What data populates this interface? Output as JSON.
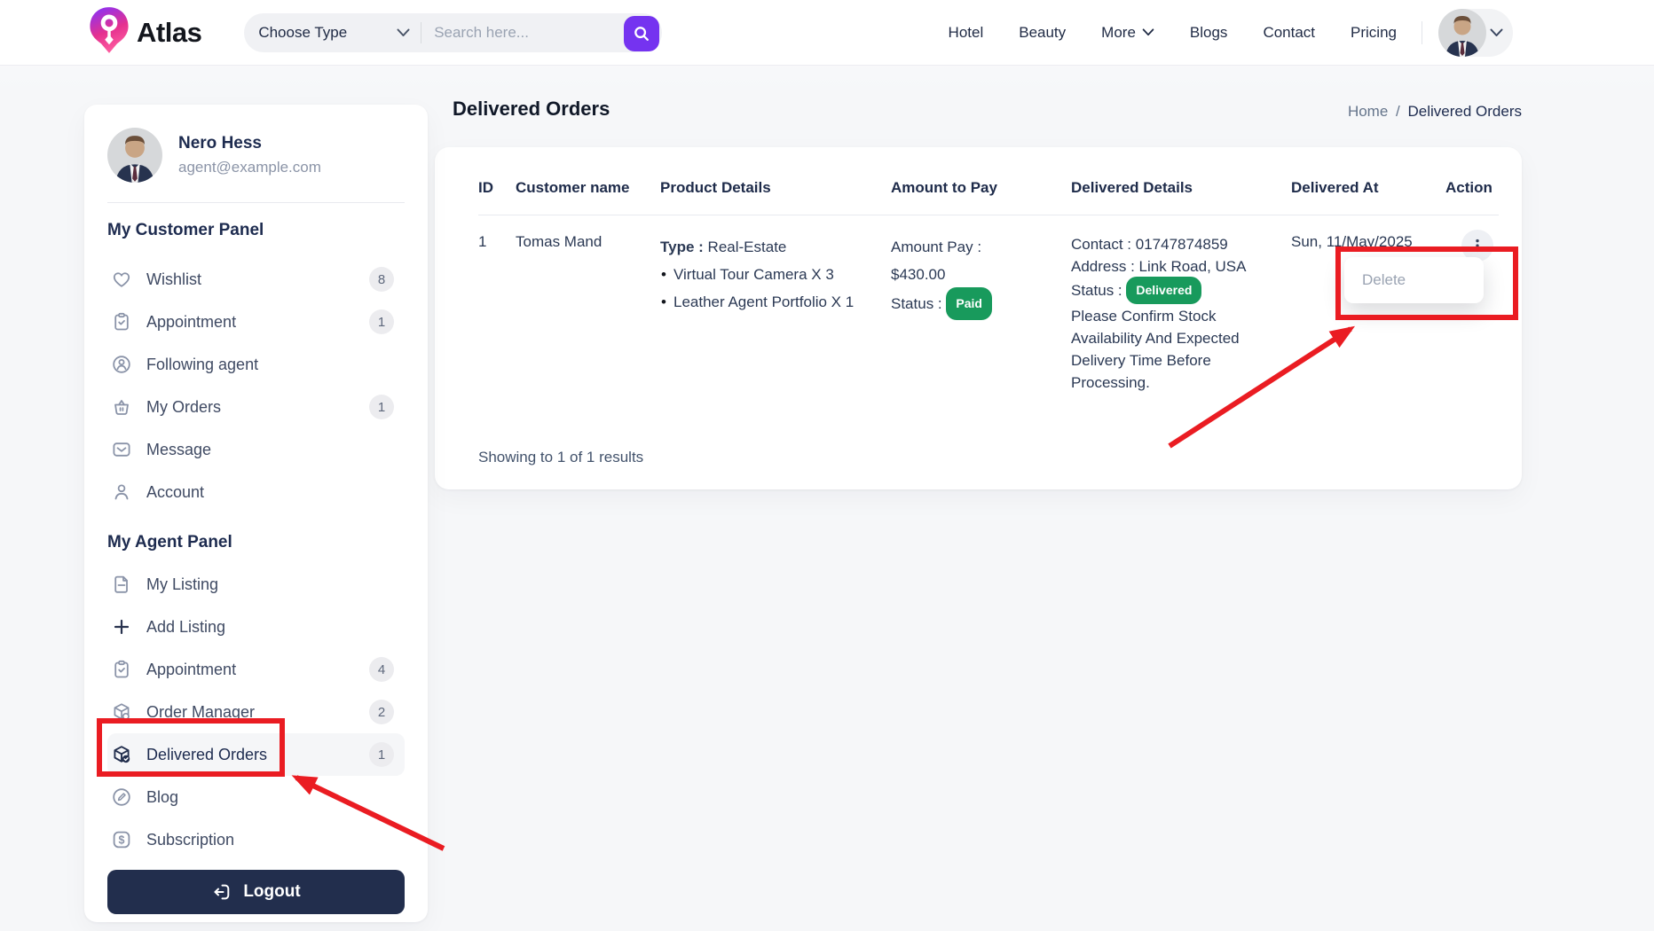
{
  "header": {
    "brand": "Atlas",
    "search": {
      "type_label": "Choose Type",
      "placeholder": "Search here..."
    },
    "nav": [
      {
        "label": "Hotel"
      },
      {
        "label": "Beauty"
      },
      {
        "label": "More"
      },
      {
        "label": "Blogs"
      },
      {
        "label": "Contact"
      },
      {
        "label": "Pricing"
      }
    ]
  },
  "sidebar": {
    "user": {
      "name": "Nero Hess",
      "email": "agent@example.com"
    },
    "sections": [
      {
        "heading": "My Customer Panel",
        "items": [
          {
            "label": "Wishlist",
            "icon": "heart-icon",
            "badge": "8"
          },
          {
            "label": "Appointment",
            "icon": "clipboard-check-icon",
            "badge": "1"
          },
          {
            "label": "Following agent",
            "icon": "user-circle-icon"
          },
          {
            "label": "My Orders",
            "icon": "basket-icon",
            "badge": "1"
          },
          {
            "label": "Message",
            "icon": "envelope-icon"
          },
          {
            "label": "Account",
            "icon": "user-icon"
          }
        ]
      },
      {
        "heading": "My Agent Panel",
        "items": [
          {
            "label": "My Listing",
            "icon": "document-icon"
          },
          {
            "label": "Add Listing",
            "icon": "plus-icon"
          },
          {
            "label": "Appointment",
            "icon": "clipboard-check-icon",
            "badge": "4"
          },
          {
            "label": "Order Manager",
            "icon": "package-search-icon",
            "badge": "2"
          },
          {
            "label": "Delivered Orders",
            "icon": "package-check-icon",
            "badge": "1",
            "active": true
          },
          {
            "label": "Blog",
            "icon": "pencil-circle-icon"
          },
          {
            "label": "Subscription",
            "icon": "dollar-icon"
          }
        ]
      }
    ],
    "logout_label": "Logout"
  },
  "main": {
    "title": "Delivered Orders",
    "breadcrumb": {
      "home": "Home",
      "separator": "/",
      "current": "Delivered Orders"
    },
    "table": {
      "columns": [
        "ID",
        "Customer name",
        "Product Details",
        "Amount to Pay",
        "Delivered Details",
        "Delivered At",
        "Action"
      ],
      "rows": [
        {
          "id": "1",
          "customer_name": "Tomas Mand",
          "product": {
            "type_label": "Type :",
            "type_value": "Real-Estate",
            "items": [
              "Virtual Tour Camera X 3",
              "Leather Agent Portfolio X 1"
            ]
          },
          "amount": {
            "line1": "Amount Pay :",
            "line2": "$430.00",
            "status_label": "Status :",
            "status_badge": "Paid"
          },
          "delivered": {
            "contact": "Contact : 01747874859",
            "address": "Address : Link Road, USA",
            "status_label": "Status :",
            "status_badge": "Delivered",
            "note": "Please Confirm Stock Availability And Expected Delivery Time Before Processing."
          },
          "delivered_at": "Sun, 11/May/2025"
        }
      ],
      "footer": "Showing to 1 of 1 results"
    },
    "action_menu": {
      "items": [
        {
          "label": "Delete"
        }
      ]
    }
  },
  "annotations": {
    "color": "#ea1c22"
  },
  "colors": {
    "accent_purple": "#7533f0",
    "badge_green": "#189a5c",
    "navy": "#222e4d",
    "annotation_red": "#ea1c22"
  }
}
